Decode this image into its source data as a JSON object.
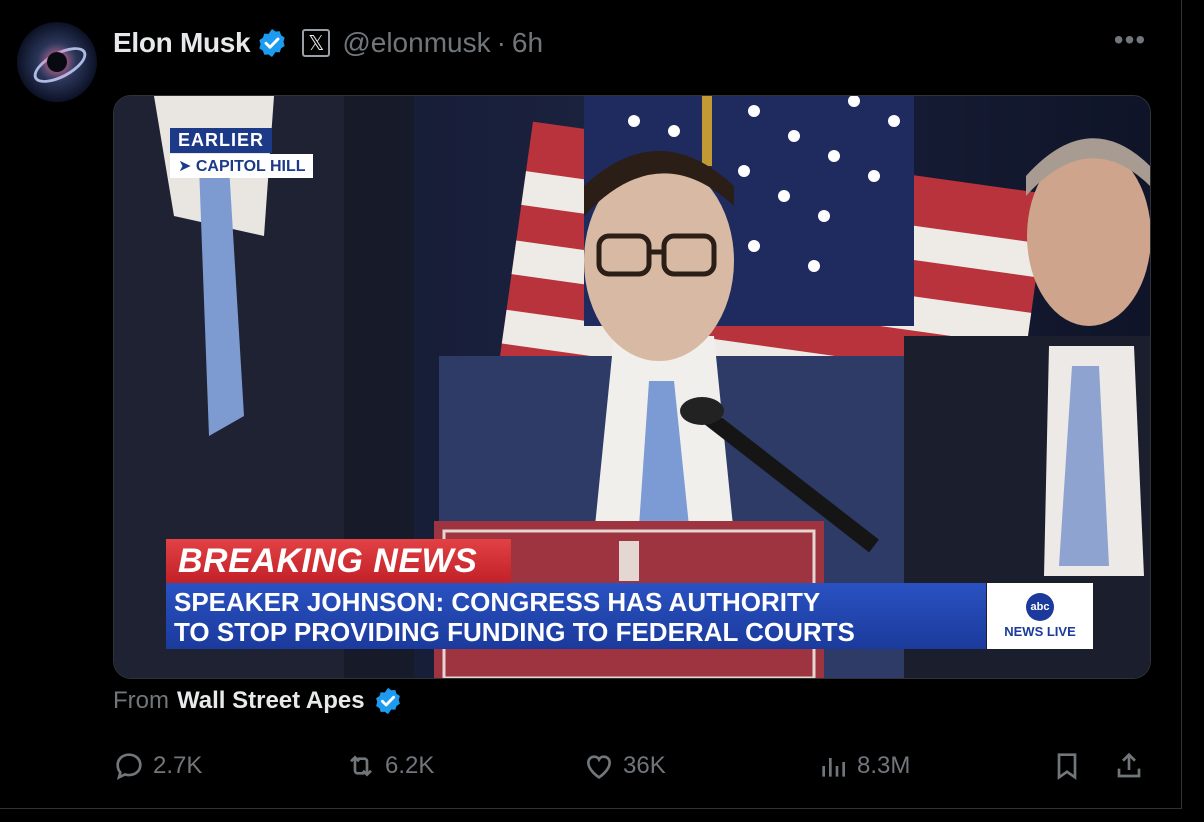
{
  "author": {
    "name": "Elon Musk",
    "handle": "@elonmusk",
    "separator": "·",
    "time": "6h",
    "x_badge": "𝕏"
  },
  "more_label": "•••",
  "media": {
    "overlay_earlier": "EARLIER",
    "overlay_location": "➤ CAPITOL HILL",
    "breaking_label": "BREAKING NEWS",
    "headline_line1": "SPEAKER JOHNSON: CONGRESS HAS AUTHORITY",
    "headline_line2": "TO STOP PROVIDING FUNDING TO FEDERAL COURTS",
    "network_logo": "abc",
    "network_live": "NEWS LIVE"
  },
  "attribution": {
    "prefix": "From",
    "source": "Wall Street Apes"
  },
  "actions": {
    "replies": "2.7K",
    "reposts": "6.2K",
    "likes": "36K",
    "views": "8.3M"
  },
  "colors": {
    "background": "#000000",
    "verified_blue": "#1d9bf0",
    "muted_text": "#71767b",
    "breaking_red": "#d02a2f",
    "headline_blue": "#2247ad"
  }
}
